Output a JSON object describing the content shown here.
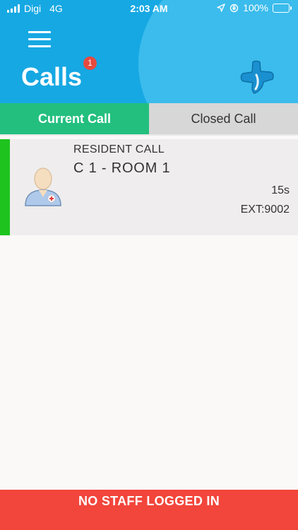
{
  "statusbar": {
    "carrier": "Digi",
    "network": "4G",
    "time": "2:03 AM",
    "battery": "100%",
    "icons": [
      "signal-icon",
      "location-arrow-icon",
      "orientation-lock-icon",
      "battery-charging-icon"
    ]
  },
  "header": {
    "title": "Calls",
    "badge_count": "1",
    "menu_icon": "hamburger-menu-icon",
    "logo_icon": "medical-cross-logo-icon"
  },
  "tabs": [
    {
      "label": "Current Call",
      "active": true
    },
    {
      "label": "Closed Call",
      "active": false
    }
  ],
  "calls": [
    {
      "type": "RESIDENT CALL",
      "room": "C 1 - ROOM 1",
      "duration": "15s",
      "extension": "EXT:9002",
      "avatar_icon": "nurse-avatar-icon",
      "status_color": "#1ec31e"
    }
  ],
  "footer": {
    "message": "NO STAFF LOGGED IN"
  },
  "colors": {
    "header": "#16a8e3",
    "active_tab": "#23bf7f",
    "inactive_tab": "#d7d7d7",
    "footer": "#f2453b",
    "badge": "#e64a3f"
  }
}
